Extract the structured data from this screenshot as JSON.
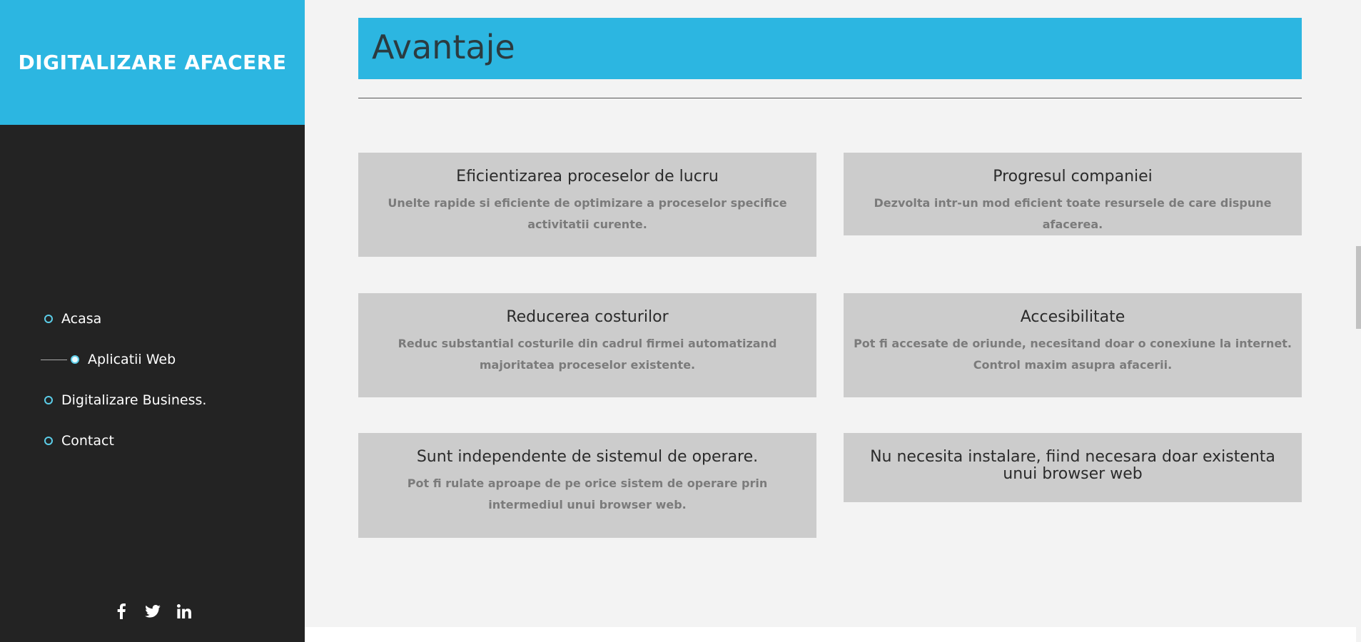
{
  "sidebar": {
    "brand": "DIGITALIZARE AFACERE",
    "nav": [
      {
        "label": "Acasa"
      },
      {
        "label": "Aplicatii Web",
        "active": true
      },
      {
        "label": "Digitalizare Business."
      },
      {
        "label": "Contact"
      }
    ],
    "social": [
      "facebook-icon",
      "twitter-icon",
      "linkedin-icon"
    ]
  },
  "main": {
    "section_title": "Avantaje",
    "cards": [
      {
        "title": "Eficientizarea proceselor de lucru",
        "text": "Unelte rapide si eficiente de optimizare a proceselor specifice activitatii curente."
      },
      {
        "title": "Progresul companiei",
        "text": "Dezvolta intr-un mod eficient toate resursele de care dispune afacerea."
      },
      {
        "title": "Reducerea costurilor",
        "text": "Reduc substantial costurile din cadrul firmei automatizand majoritatea proceselor existente."
      },
      {
        "title": "Accesibilitate",
        "text": "Pot fi accesate de oriunde, necesitand doar o conexiune la internet. Control maxim asupra afacerii."
      },
      {
        "title": "Sunt independente de sistemul de operare.",
        "text": "Pot fi rulate aproape de pe orice sistem de operare prin intermediul unui browser web."
      },
      {
        "title": "Nu necesita instalare, fiind necesara doar existenta unui browser web",
        "text": ""
      }
    ]
  },
  "colors": {
    "accent": "#2cb6e1",
    "sidebar_bg": "#232323",
    "card_bg": "#cccccc",
    "page_bg": "#f3f3f3"
  }
}
